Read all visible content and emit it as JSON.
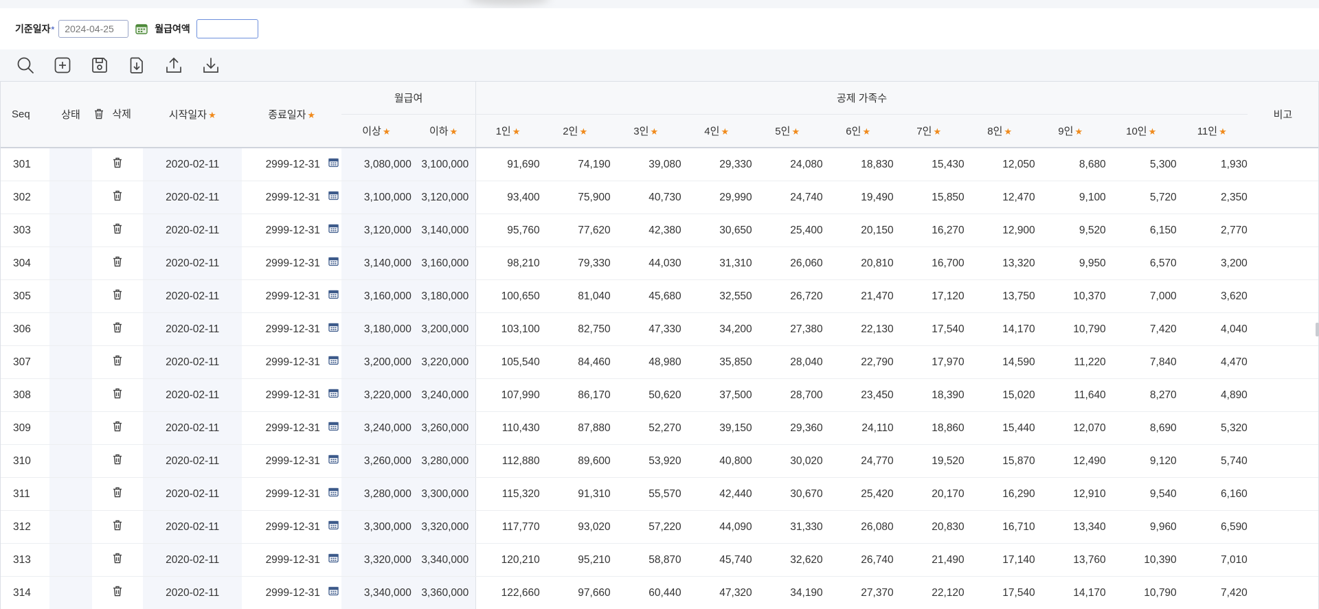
{
  "filter": {
    "base_date_label": "기준일자",
    "base_date_required": "*",
    "base_date_value": "2024-04-25",
    "salary_label": "월급여액",
    "salary_value": ""
  },
  "toolbar": {
    "icons": [
      "search-icon",
      "add-icon",
      "save-icon",
      "import-icon",
      "upload-icon",
      "download-icon"
    ]
  },
  "grid": {
    "headers": {
      "seq": "Seq",
      "status": "상태",
      "delete": "삭제",
      "start_date": "시작일자",
      "end_date": "종료일자",
      "salary_group": "월급여",
      "over": "이상",
      "under": "이하",
      "family_group": "공제 가족수",
      "family": [
        "1인",
        "2인",
        "3인",
        "4인",
        "5인",
        "6인",
        "7인",
        "8인",
        "9인",
        "10인",
        "11인"
      ],
      "remark": "비고",
      "required_mark": "★"
    },
    "rows": [
      {
        "seq": "301",
        "start": "2020-02-11",
        "end": "2999-12-31",
        "over": "3,080,000",
        "under": "3,100,000",
        "fam": [
          "91,690",
          "74,190",
          "39,080",
          "29,330",
          "24,080",
          "18,830",
          "15,430",
          "12,050",
          "8,680",
          "5,300",
          "1,930"
        ]
      },
      {
        "seq": "302",
        "start": "2020-02-11",
        "end": "2999-12-31",
        "over": "3,100,000",
        "under": "3,120,000",
        "fam": [
          "93,400",
          "75,900",
          "40,730",
          "29,990",
          "24,740",
          "19,490",
          "15,850",
          "12,470",
          "9,100",
          "5,720",
          "2,350"
        ]
      },
      {
        "seq": "303",
        "start": "2020-02-11",
        "end": "2999-12-31",
        "over": "3,120,000",
        "under": "3,140,000",
        "fam": [
          "95,760",
          "77,620",
          "42,380",
          "30,650",
          "25,400",
          "20,150",
          "16,270",
          "12,900",
          "9,520",
          "6,150",
          "2,770"
        ]
      },
      {
        "seq": "304",
        "start": "2020-02-11",
        "end": "2999-12-31",
        "over": "3,140,000",
        "under": "3,160,000",
        "fam": [
          "98,210",
          "79,330",
          "44,030",
          "31,310",
          "26,060",
          "20,810",
          "16,700",
          "13,320",
          "9,950",
          "6,570",
          "3,200"
        ]
      },
      {
        "seq": "305",
        "start": "2020-02-11",
        "end": "2999-12-31",
        "over": "3,160,000",
        "under": "3,180,000",
        "fam": [
          "100,650",
          "81,040",
          "45,680",
          "32,550",
          "26,720",
          "21,470",
          "17,120",
          "13,750",
          "10,370",
          "7,000",
          "3,620"
        ]
      },
      {
        "seq": "306",
        "start": "2020-02-11",
        "end": "2999-12-31",
        "over": "3,180,000",
        "under": "3,200,000",
        "fam": [
          "103,100",
          "82,750",
          "47,330",
          "34,200",
          "27,380",
          "22,130",
          "17,540",
          "14,170",
          "10,790",
          "7,420",
          "4,040"
        ]
      },
      {
        "seq": "307",
        "start": "2020-02-11",
        "end": "2999-12-31",
        "over": "3,200,000",
        "under": "3,220,000",
        "fam": [
          "105,540",
          "84,460",
          "48,980",
          "35,850",
          "28,040",
          "22,790",
          "17,970",
          "14,590",
          "11,220",
          "7,840",
          "4,470"
        ]
      },
      {
        "seq": "308",
        "start": "2020-02-11",
        "end": "2999-12-31",
        "over": "3,220,000",
        "under": "3,240,000",
        "fam": [
          "107,990",
          "86,170",
          "50,620",
          "37,500",
          "28,700",
          "23,450",
          "18,390",
          "15,020",
          "11,640",
          "8,270",
          "4,890"
        ]
      },
      {
        "seq": "309",
        "start": "2020-02-11",
        "end": "2999-12-31",
        "over": "3,240,000",
        "under": "3,260,000",
        "fam": [
          "110,430",
          "87,880",
          "52,270",
          "39,150",
          "29,360",
          "24,110",
          "18,860",
          "15,440",
          "12,070",
          "8,690",
          "5,320"
        ]
      },
      {
        "seq": "310",
        "start": "2020-02-11",
        "end": "2999-12-31",
        "over": "3,260,000",
        "under": "3,280,000",
        "fam": [
          "112,880",
          "89,600",
          "53,920",
          "40,800",
          "30,020",
          "24,770",
          "19,520",
          "15,870",
          "12,490",
          "9,120",
          "5,740"
        ]
      },
      {
        "seq": "311",
        "start": "2020-02-11",
        "end": "2999-12-31",
        "over": "3,280,000",
        "under": "3,300,000",
        "fam": [
          "115,320",
          "91,310",
          "55,570",
          "42,440",
          "30,670",
          "25,420",
          "20,170",
          "16,290",
          "12,910",
          "9,540",
          "6,160"
        ]
      },
      {
        "seq": "312",
        "start": "2020-02-11",
        "end": "2999-12-31",
        "over": "3,300,000",
        "under": "3,320,000",
        "fam": [
          "117,770",
          "93,020",
          "57,220",
          "44,090",
          "31,330",
          "26,080",
          "20,830",
          "16,710",
          "13,340",
          "9,960",
          "6,590"
        ]
      },
      {
        "seq": "313",
        "start": "2020-02-11",
        "end": "2999-12-31",
        "over": "3,320,000",
        "under": "3,340,000",
        "fam": [
          "120,210",
          "95,210",
          "58,870",
          "45,740",
          "32,620",
          "26,740",
          "21,490",
          "17,140",
          "13,760",
          "10,390",
          "7,010"
        ]
      },
      {
        "seq": "314",
        "start": "2020-02-11",
        "end": "2999-12-31",
        "over": "3,340,000",
        "under": "3,360,000",
        "fam": [
          "122,660",
          "97,660",
          "60,440",
          "47,320",
          "34,190",
          "27,370",
          "22,120",
          "17,540",
          "14,170",
          "10,790",
          "7,420"
        ]
      }
    ]
  }
}
